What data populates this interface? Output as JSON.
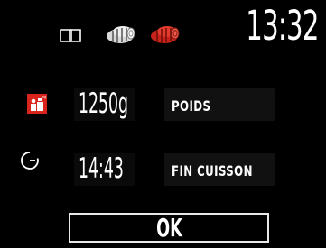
{
  "header": {
    "time": "13:32",
    "icons": [
      "book-icon",
      "roast-icon",
      "roast-icon-active"
    ],
    "accent_color": "#d8241c"
  },
  "weight_row": {
    "icon": "weight-icon",
    "value": "1250g",
    "label": "POIDS"
  },
  "finish_row": {
    "icon": "timer-icon",
    "value": "14:43",
    "label": "FIN CUISSON"
  },
  "ok_button": {
    "label": "OK"
  }
}
